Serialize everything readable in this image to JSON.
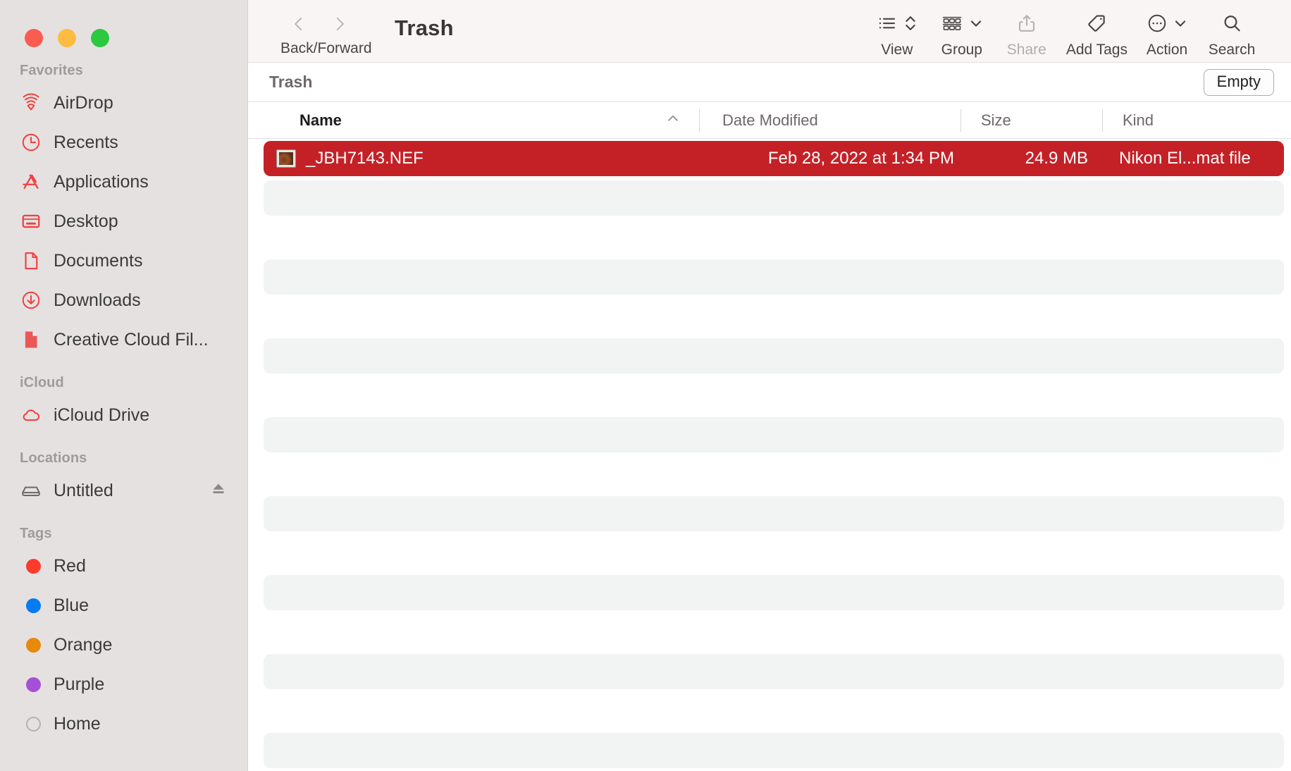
{
  "window": {
    "traffic_lights": [
      "close",
      "minimize",
      "zoom"
    ]
  },
  "toolbar": {
    "nav_label": "Back/Forward",
    "title": "Trash",
    "buttons": [
      {
        "label": "View",
        "icon": "list-view-icon",
        "disabled": false
      },
      {
        "label": "Group",
        "icon": "group-grid-icon",
        "disabled": false
      },
      {
        "label": "Share",
        "icon": "share-icon",
        "disabled": true
      },
      {
        "label": "Add Tags",
        "icon": "tag-icon",
        "disabled": false
      },
      {
        "label": "Action",
        "icon": "ellipsis-circle-icon",
        "disabled": false
      },
      {
        "label": "Search",
        "icon": "search-icon",
        "disabled": false
      }
    ]
  },
  "subbar": {
    "title": "Trash",
    "empty_label": "Empty"
  },
  "columns": [
    {
      "key": "name",
      "label": "Name",
      "sorted": true,
      "sort_dir": "asc"
    },
    {
      "key": "date",
      "label": "Date Modified",
      "sorted": false
    },
    {
      "key": "size",
      "label": "Size",
      "sorted": false
    },
    {
      "key": "kind",
      "label": "Kind",
      "sorted": false
    }
  ],
  "files": [
    {
      "name": "_JBH7143.NEF",
      "date": "Feb 28, 2022 at 1:34 PM",
      "size": "24.9 MB",
      "kind": "Nikon El...mat file",
      "selected": true,
      "icon": "raw-photo-thumbnail"
    }
  ],
  "sidebar": {
    "sections": [
      {
        "header": "Favorites",
        "items": [
          {
            "label": "AirDrop",
            "icon": "airdrop-icon",
            "color": "#F1403F"
          },
          {
            "label": "Recents",
            "icon": "clock-icon",
            "color": "#F1403F"
          },
          {
            "label": "Applications",
            "icon": "applications-icon",
            "color": "#F1403F"
          },
          {
            "label": "Desktop",
            "icon": "desktop-icon",
            "color": "#F1403F"
          },
          {
            "label": "Documents",
            "icon": "document-icon",
            "color": "#F1403F"
          },
          {
            "label": "Downloads",
            "icon": "download-icon",
            "color": "#F1403F"
          },
          {
            "label": "Creative Cloud Fil...",
            "icon": "creative-cloud-files-icon",
            "color": "#EB5757"
          }
        ]
      },
      {
        "header": "iCloud",
        "items": [
          {
            "label": "iCloud Drive",
            "icon": "cloud-icon",
            "color": "#F1403F"
          }
        ]
      },
      {
        "header": "Locations",
        "items": [
          {
            "label": "Untitled",
            "icon": "harddisk-icon",
            "color": "#6E6868",
            "eject": true
          }
        ]
      },
      {
        "header": "Tags",
        "items": [
          {
            "label": "Red",
            "icon": "tag-dot-red",
            "color": "#FC3B2D"
          },
          {
            "label": "Blue",
            "icon": "tag-dot-blue",
            "color": "#077BF1"
          },
          {
            "label": "Orange",
            "icon": "tag-dot-orange",
            "color": "#E8890C"
          },
          {
            "label": "Purple",
            "icon": "tag-dot-purple",
            "color": "#A550D6"
          },
          {
            "label": "Home",
            "icon": "tag-dot-none",
            "color": "transparent"
          }
        ]
      }
    ]
  },
  "colors": {
    "selection_red": "#C42127",
    "sidebar_bg": "#E6E1E1",
    "toolbar_bg": "#FAF5F5",
    "stripe": "#F2F4F3"
  }
}
